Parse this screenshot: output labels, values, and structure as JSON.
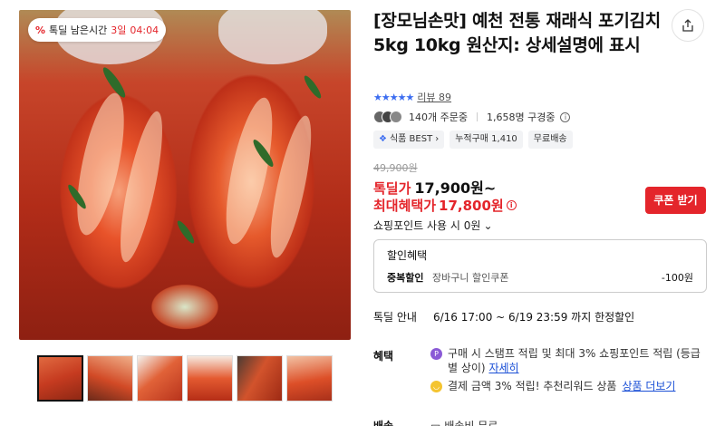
{
  "timer": {
    "label": "톡딜 남은시간",
    "days": "3일",
    "time": "04:04"
  },
  "product": {
    "title": "[장모님손맛] 예천 전통 재래식 포기김치 5kg 10kg 원산지: 상세설명에 표시",
    "rating_stars": "★★★★★",
    "review_label": "리뷰 89",
    "order_count": "140개 주문중",
    "subscriber_count": "1,658명 구경중",
    "tags": [
      "식품 BEST",
      "누적구매 1,410",
      "무료배송"
    ]
  },
  "price": {
    "original": "49,900원",
    "deal_label": "톡딜가",
    "deal_price": "17,900원~",
    "max_label": "최대혜택가",
    "max_price": "17,800원",
    "coupon_button": "쿠폰 받기",
    "point_usage": "쇼핑포인트 사용 시 0원"
  },
  "discount": {
    "header": "할인혜택",
    "item_label": "중복할인",
    "item_desc": "장바구니 할인쿠폰",
    "item_amount": "-100원"
  },
  "deal_info": {
    "label": "톡딜 안내",
    "period": "6/16 17:00 ~ 6/19 23:59 까지 한정할인"
  },
  "benefits": {
    "label": "혜택",
    "item1_text": "구매 시 스탬프 적립 및 최대 3% 쇼핑포인트 적립 (등급별 상이)",
    "item1_link": "자세히",
    "item2_text": "결제 금액 3% 적립! 추천리워드 상품",
    "item2_link": "상품 더보기"
  },
  "delivery": {
    "label": "배송",
    "value": "배송비 무료"
  },
  "colors": {
    "accent_red": "#e4252b",
    "link_blue": "#1a4fd6",
    "star_blue": "#3b6cf0"
  }
}
